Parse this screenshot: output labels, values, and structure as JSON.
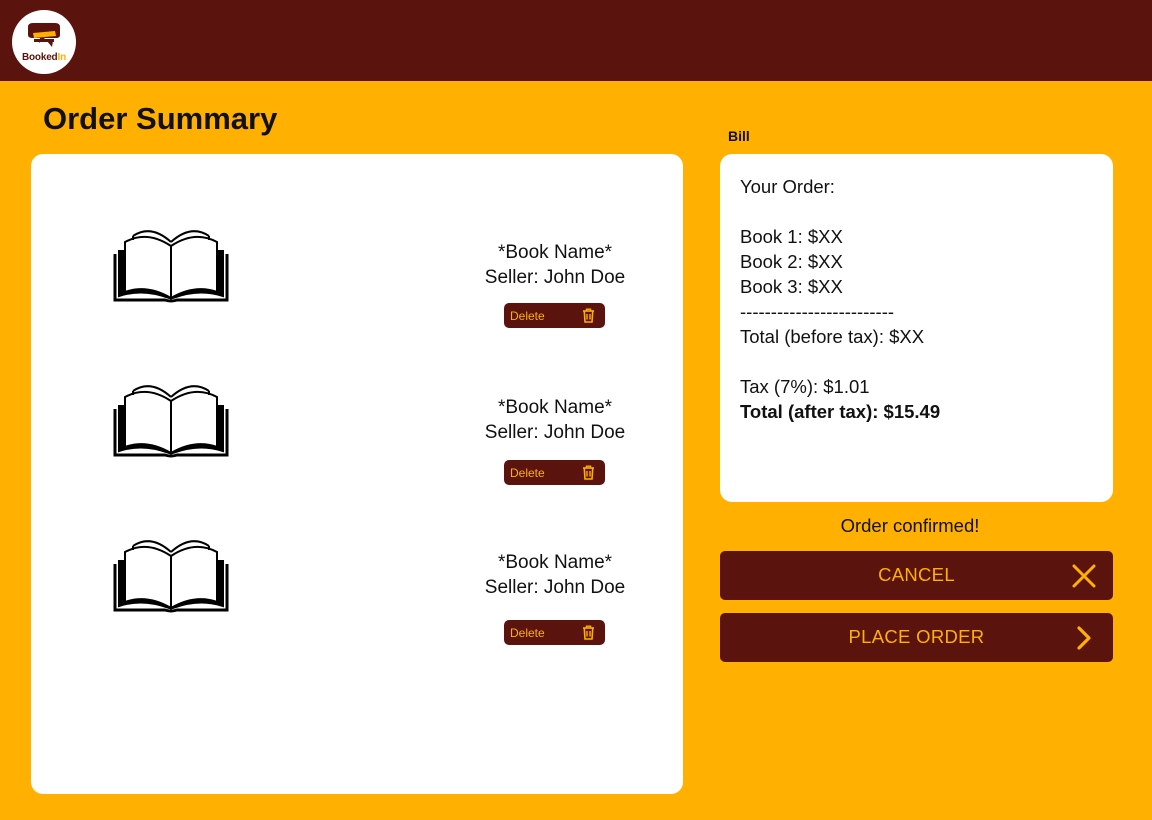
{
  "app": {
    "logo_text_1": "Booked",
    "logo_text_2": "In"
  },
  "page": {
    "title": "Order Summary",
    "bill_label": "Bill"
  },
  "cart": {
    "items": [
      {
        "name": "*Book Name*",
        "seller": "Seller: John Doe",
        "delete_label": "Delete",
        "icon": "open-book-icon"
      },
      {
        "name": "*Book Name*",
        "seller": "Seller: John Doe",
        "delete_label": "Delete",
        "icon": "open-book-icon"
      },
      {
        "name": "*Book Name*",
        "seller": "Seller: John Doe",
        "delete_label": "Delete",
        "icon": "open-book-icon"
      }
    ]
  },
  "bill": {
    "heading": "Your Order:",
    "lines": [
      "Book 1: $XX",
      "Book 2: $XX",
      "Book 3: $XX"
    ],
    "divider": "-------------------------",
    "total_before_tax": "Total (before tax): $XX",
    "tax": "Tax (7%): $1.01",
    "total_after_tax": "Total (after tax): $15.49"
  },
  "status": {
    "message": "Order confirmed!"
  },
  "actions": {
    "cancel_label": "CANCEL",
    "cancel_icon": "close-icon",
    "place_order_label": "PLACE ORDER",
    "place_order_icon": "chevron-right-icon"
  },
  "colors": {
    "background": "#FFB000",
    "brand_dark": "#5A130D",
    "panel": "#FFFFFF",
    "accent_text": "#FFB000"
  }
}
